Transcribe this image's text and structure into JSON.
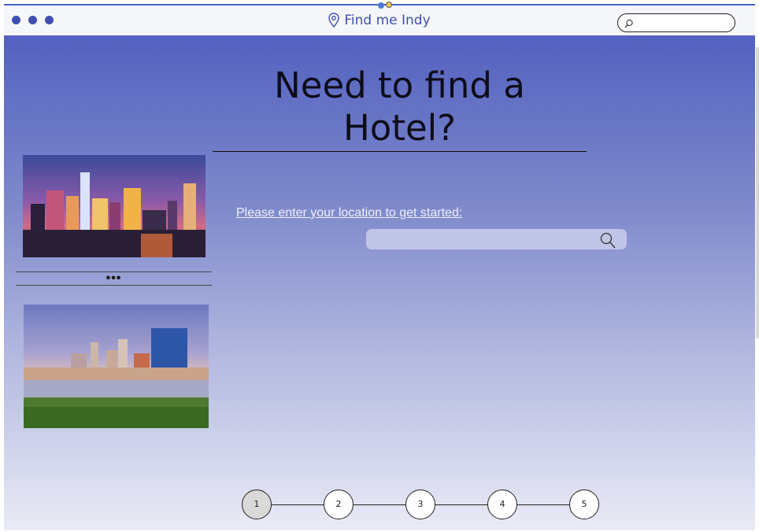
{
  "window": {
    "title": "Find me Indy"
  },
  "top_search": {
    "placeholder": ""
  },
  "main": {
    "headline": "Need to find a Hotel?",
    "prompt": "Please enter your location to get started:",
    "location_search": {
      "placeholder": ""
    },
    "more_label": "•••"
  },
  "stepper": {
    "steps": [
      "1",
      "2",
      "3",
      "4",
      "5"
    ],
    "active": "1"
  },
  "colors": {
    "accent": "#3f4fb1",
    "gradient_top": "#5361c0",
    "gradient_bottom": "#e9ebf6",
    "search_bg": "#c0c5e8"
  },
  "icons": {
    "title": "map-pin-icon",
    "search": "magnifier-icon",
    "window_controls": "dot-icon"
  }
}
